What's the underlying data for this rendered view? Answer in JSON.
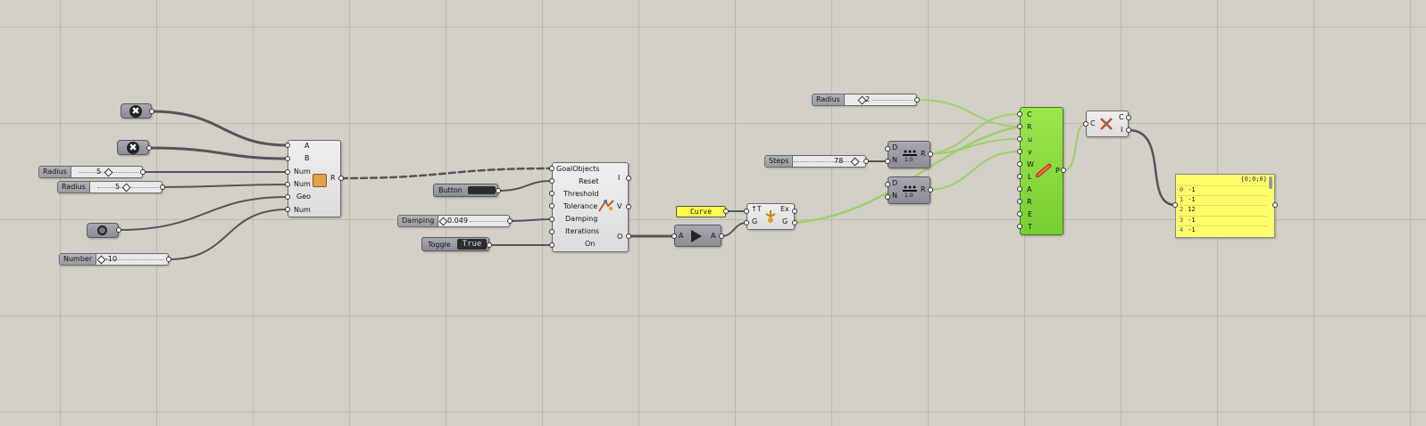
{
  "colors": {
    "canvas": "#d4d0c8",
    "wire": "#4a4a4a",
    "wire_selected": "#8fc85a",
    "green_component": "#86d43e",
    "panel": "#ffff6e"
  },
  "components": {
    "close1": {
      "icon": "close-icon"
    },
    "close2": {
      "icon": "close-icon"
    },
    "circle": {
      "icon": "circle-icon"
    },
    "collider": {
      "inputs": [
        "A",
        "B",
        "Num",
        "Num",
        "Geo",
        "Num"
      ],
      "output": "R",
      "icon": "box-icon"
    },
    "slider_radius1": {
      "name": "Radius",
      "value": "5"
    },
    "slider_radius2": {
      "name": "Radius",
      "value": "5"
    },
    "slider_number": {
      "name": "Number",
      "value": "-10"
    },
    "button": {
      "name": "Button"
    },
    "slider_damping": {
      "name": "Damping",
      "value": "0.049"
    },
    "toggle": {
      "name": "Toggle",
      "value": "True"
    },
    "solver": {
      "inputs": [
        "GoalObjects",
        "Reset",
        "Threshold",
        "Tolerance",
        "Damping",
        "Iterations",
        "On"
      ],
      "outputs": [
        "I",
        "V",
        "O"
      ],
      "icon": "solver-icon"
    },
    "curve": {
      "label": "Curve"
    },
    "relay": {
      "input": "A",
      "output": "A",
      "icon": "play-icon"
    },
    "explode": {
      "inputs": [
        "↑T",
        "G"
      ],
      "outputs": [
        "Ex",
        "G"
      ],
      "icon": "explode-icon"
    },
    "slider_radius3": {
      "name": "Radius",
      "value": "2"
    },
    "slider_steps": {
      "name": "Steps",
      "value": "78"
    },
    "divide1": {
      "inputs": [
        "D",
        "N"
      ],
      "output": "R",
      "icon": "divide-icon",
      "sub": "1.0"
    },
    "divide2": {
      "inputs": [
        "D",
        "N"
      ],
      "output": "R",
      "icon": "divide-icon",
      "sub": "1.0"
    },
    "pipe": {
      "inputs": [
        "C",
        "R",
        "u",
        "v",
        "W",
        "L",
        "A",
        "R",
        "E",
        "T"
      ],
      "output": "P",
      "icon": "pipe-icon"
    },
    "measure": {
      "inputs": [
        "C"
      ],
      "outputs": [
        "C",
        "I"
      ],
      "icon": "measure-icon"
    },
    "panel": {
      "path": "{0;0;0}",
      "rows": [
        {
          "i": "0",
          "v": "-1"
        },
        {
          "i": "1",
          "v": "-1"
        },
        {
          "i": "2",
          "v": "12"
        },
        {
          "i": "3",
          "v": "-1"
        },
        {
          "i": "4",
          "v": "-1"
        }
      ]
    }
  }
}
